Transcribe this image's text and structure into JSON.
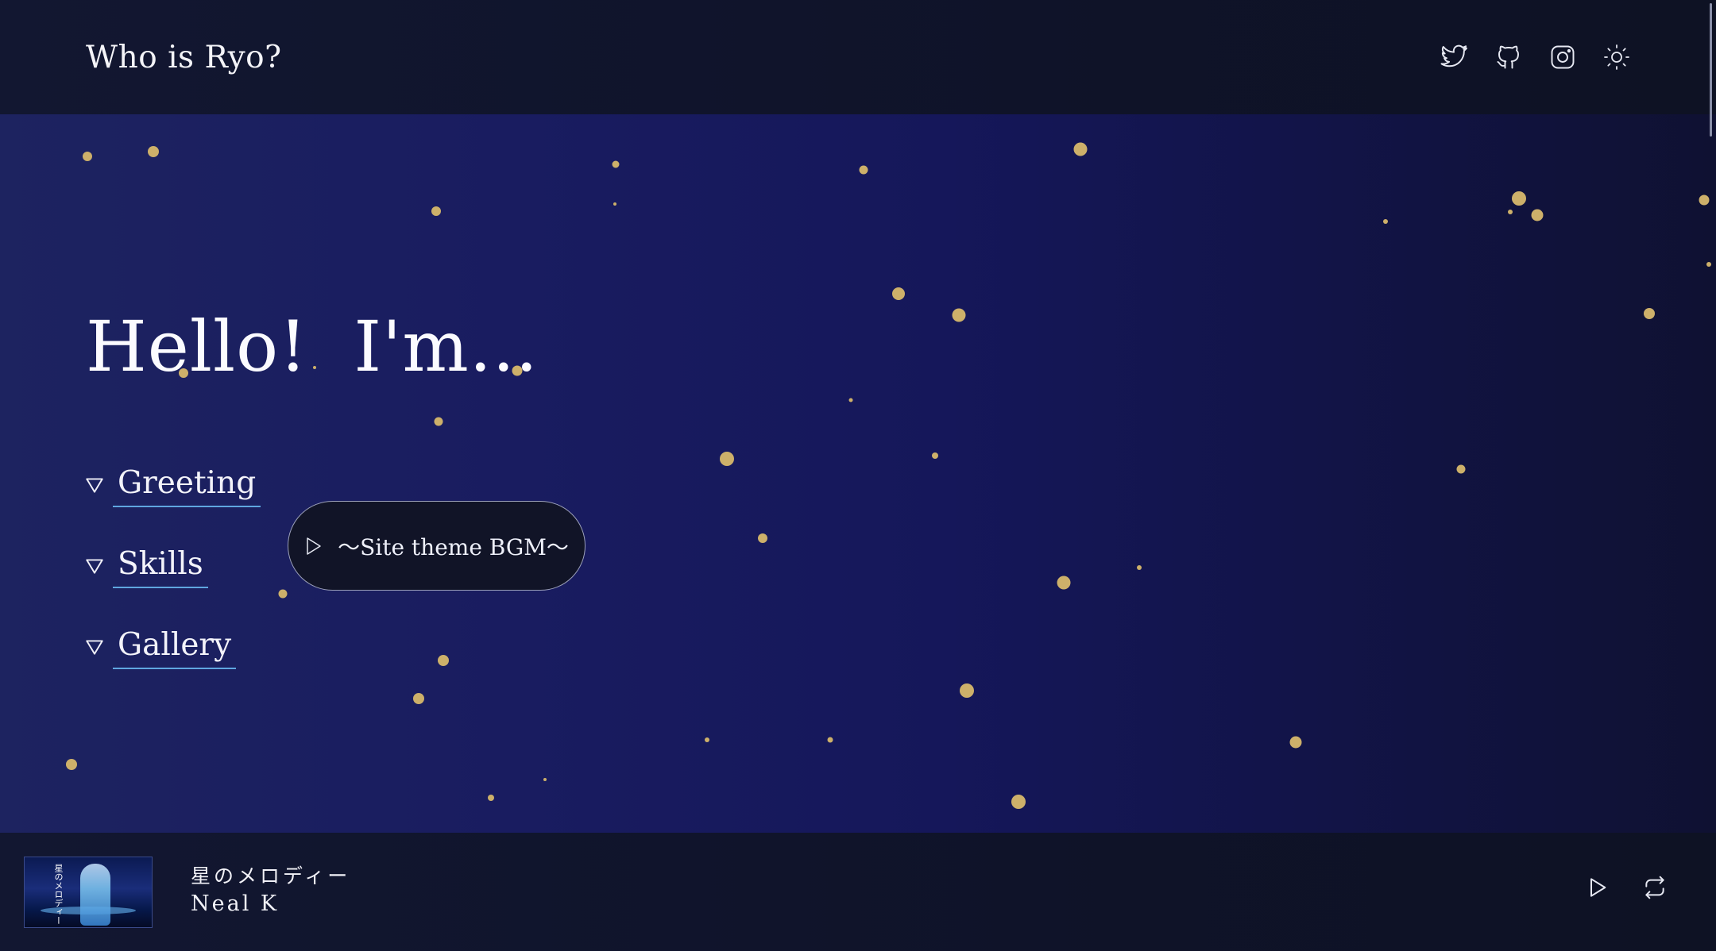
{
  "header": {
    "title": "Who is Ryo?",
    "icons": [
      "twitter-icon",
      "github-icon",
      "instagram-icon",
      "sun-icon"
    ]
  },
  "hero": {
    "title": "Hello!  I'm..."
  },
  "nav": {
    "items": [
      {
        "label": "Greeting",
        "icon": "triangle-down-icon"
      },
      {
        "label": "Skills",
        "icon": "triangle-down-icon"
      },
      {
        "label": "Gallery",
        "icon": "triangle-down-icon"
      }
    ]
  },
  "bgm_button": {
    "label": "〜Site theme BGM〜",
    "icon": "play-icon"
  },
  "player": {
    "track_title": "星のメロディー",
    "artist": "Neal K",
    "album_art_text": "星のメロディー",
    "controls": [
      "play-icon",
      "repeat-icon"
    ]
  },
  "colors": {
    "particle": "#cdb06a",
    "accent_underline": "#5fa6e0",
    "header_bg": "#101428",
    "hero_bg_left": "#1d2360",
    "hero_bg_right": "#0f1132"
  }
}
